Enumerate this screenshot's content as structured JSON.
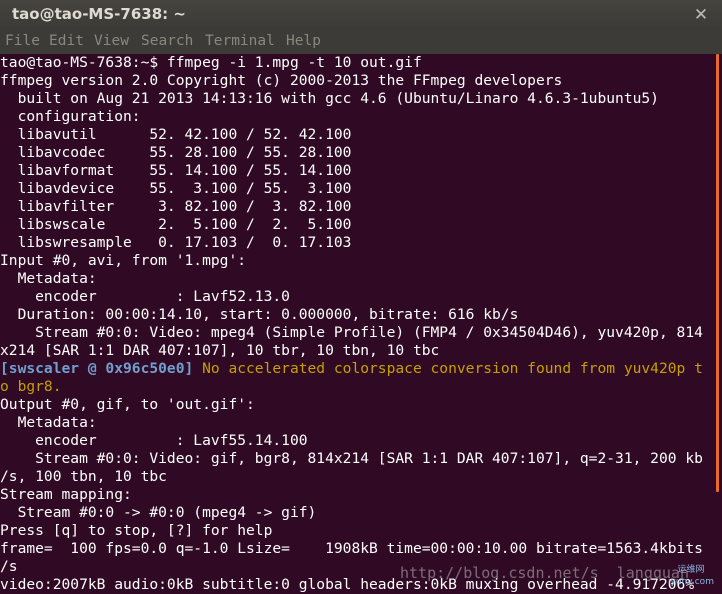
{
  "window": {
    "title": "tao@tao-MS-7638: ~",
    "close_glyph": "✕"
  },
  "menubar": {
    "items": [
      "File",
      "Edit",
      "View",
      "Search",
      "Terminal",
      "Help"
    ]
  },
  "terminal": {
    "lines": [
      "tao@tao-MS-7638:~$ ffmpeg -i 1.mpg -t 10 out.gif",
      "ffmpeg version 2.0 Copyright (c) 2000-2013 the FFmpeg developers",
      "  built on Aug 21 2013 14:13:16 with gcc 4.6 (Ubuntu/Linaro 4.6.3-1ubuntu5)",
      "  configuration:",
      "  libavutil      52. 42.100 / 52. 42.100",
      "  libavcodec     55. 28.100 / 55. 28.100",
      "  libavformat    55. 14.100 / 55. 14.100",
      "  libavdevice    55.  3.100 / 55.  3.100",
      "  libavfilter     3. 82.100 /  3. 82.100",
      "  libswscale      2.  5.100 /  2.  5.100",
      "  libswresample   0. 17.103 /  0. 17.103",
      "Input #0, avi, from '1.mpg':",
      "  Metadata:",
      "    encoder         : Lavf52.13.0",
      "  Duration: 00:00:14.10, start: 0.000000, bitrate: 616 kb/s",
      "    Stream #0:0: Video: mpeg4 (Simple Profile) (FMP4 / 0x34504D46), yuv420p, 814",
      "x214 [SAR 1:1 DAR 407:107], 10 tbr, 10 tbn, 10 tbc"
    ],
    "warning": {
      "tag": "[swscaler @ 0x96c50e0]",
      "message": " No accelerated colorspace conversion found from yuv420p t",
      "continuation": "o bgr8."
    },
    "lines_after": [
      "Output #0, gif, to 'out.gif':",
      "  Metadata:",
      "    encoder         : Lavf55.14.100",
      "    Stream #0:0: Video: gif, bgr8, 814x214 [SAR 1:1 DAR 407:107], q=2-31, 200 kb",
      "/s, 100 tbn, 10 tbc",
      "Stream mapping:",
      "  Stream #0:0 -> #0:0 (mpeg4 -> gif)",
      "Press [q] to stop, [?] for help",
      "frame=  100 fps=0.0 q=-1.0 Lsize=    1908kB time=00:00:10.00 bitrate=1563.4kbits",
      "/s",
      "video:2007kB audio:0kB subtitle:0 global headers:0kB muxing overhead -4.917206%"
    ]
  },
  "watermark": {
    "text": "http://blog.csdn.net/s  langquan",
    "logo_line1": "运维网",
    "logo_line2": "iyunv.com"
  }
}
